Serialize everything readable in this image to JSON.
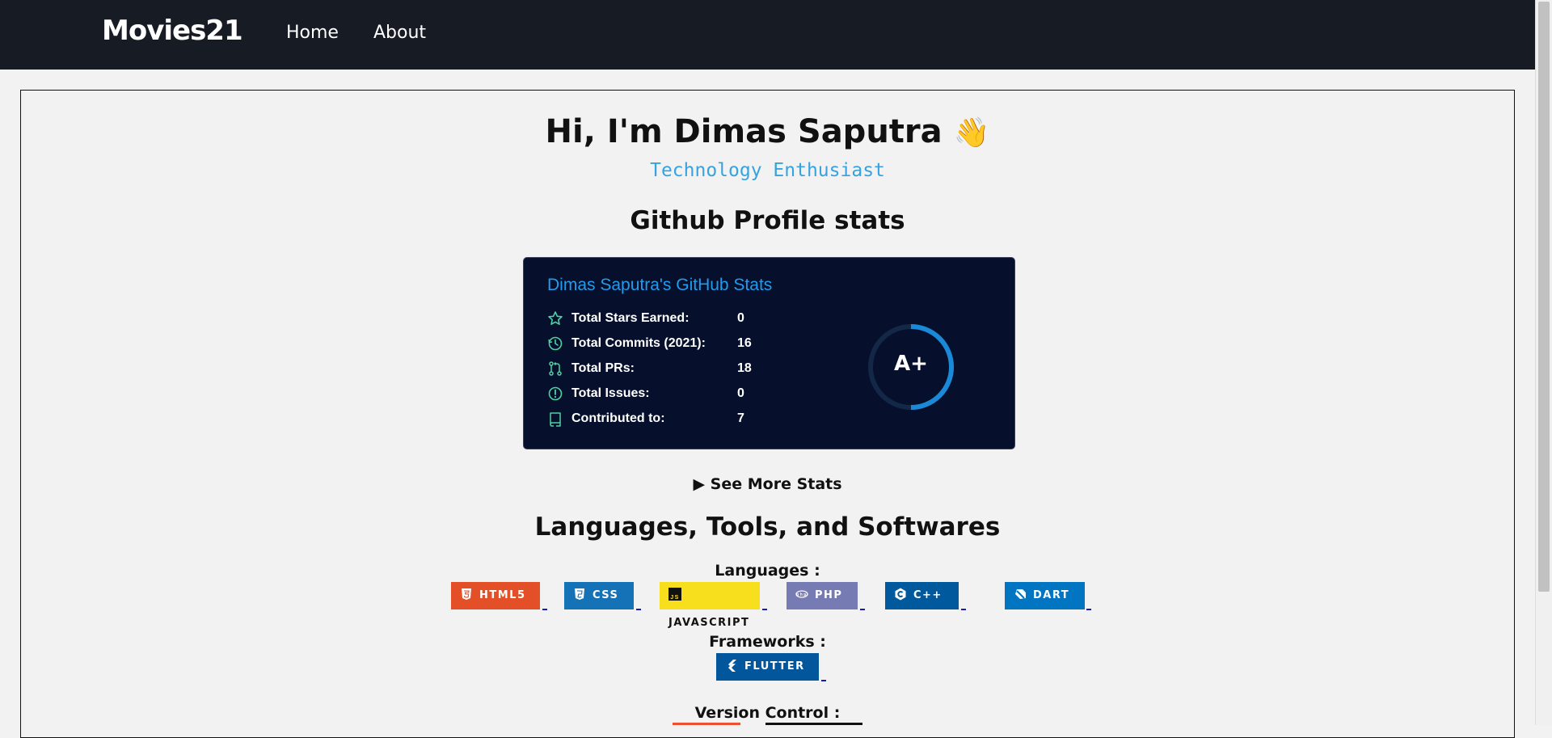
{
  "nav": {
    "brand": "Movies21",
    "links": [
      "Home",
      "About"
    ]
  },
  "profile": {
    "greeting": "Hi, I'm Dimas Saputra",
    "wave_emoji": "👋",
    "tagline": "Technology Enthusiast"
  },
  "stats_section": {
    "heading": "Github Profile stats",
    "card_title": "Dimas Saputra's GitHub Stats",
    "rows": [
      {
        "label": "Total Stars Earned:",
        "value": "0",
        "icon": "star-icon"
      },
      {
        "label": "Total Commits (2021):",
        "value": "16",
        "icon": "clock-icon"
      },
      {
        "label": "Total PRs:",
        "value": "18",
        "icon": "pull-request-icon"
      },
      {
        "label": "Total Issues:",
        "value": "0",
        "icon": "issue-icon"
      },
      {
        "label": "Contributed to:",
        "value": "7",
        "icon": "repo-icon"
      }
    ],
    "grade": "A+",
    "see_more": "▶ See More Stats"
  },
  "skills": {
    "heading": "Languages, Tools, and Softwares",
    "languages_label": "Languages :",
    "languages": [
      {
        "label": "HTML5",
        "color": "#e34f26",
        "icon": "html5-icon"
      },
      {
        "label": "CSS",
        "color": "#1572b6",
        "icon": "css3-icon"
      },
      {
        "label": "JAVASCRIPT",
        "color": "#f7df1e",
        "icon": "javascript-icon"
      },
      {
        "label": "PHP",
        "color": "#777bb4",
        "icon": "php-icon"
      },
      {
        "label": "C++",
        "color": "#00599c",
        "icon": "cplusplus-icon"
      },
      {
        "label": "DART",
        "color": "#0175c2",
        "icon": "dart-icon"
      }
    ],
    "frameworks_label": "Frameworks :",
    "frameworks": [
      {
        "label": "FLUTTER",
        "color": "#02569b",
        "icon": "flutter-icon"
      }
    ],
    "version_control_label": "Version Control :"
  },
  "colors": {
    "navbar_bg": "#171b24",
    "card_bg": "#060f2b",
    "accent_blue": "#1e9df0",
    "icon_teal": "#4fd1a5"
  }
}
